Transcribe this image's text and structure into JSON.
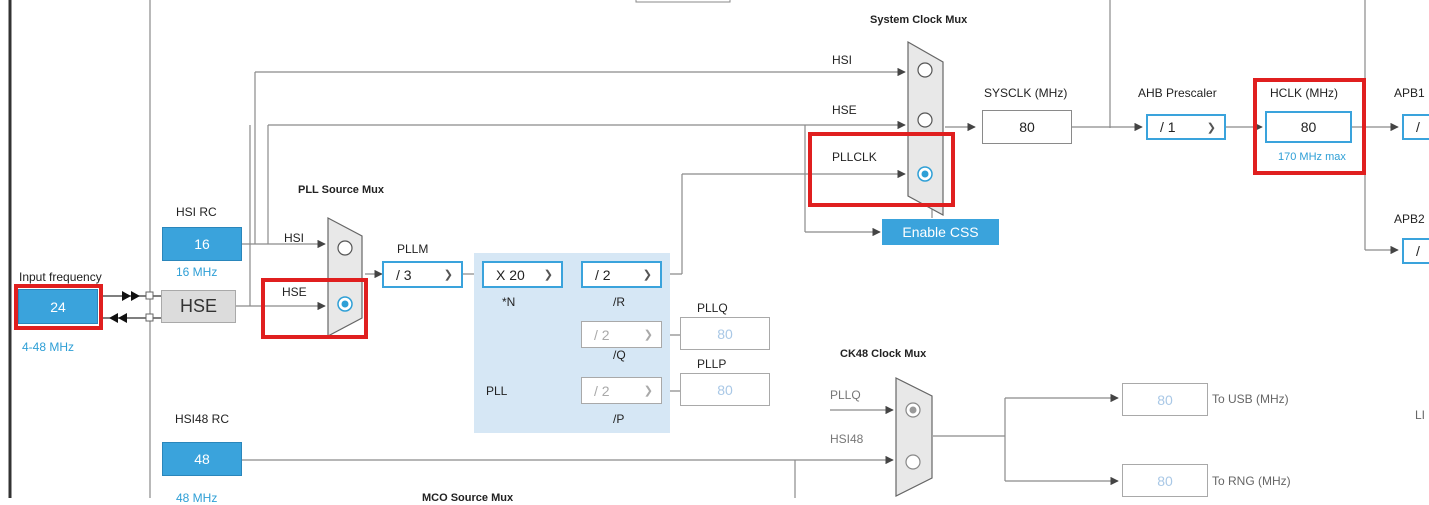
{
  "diagram": {
    "system_clock_mux": {
      "title": "System Clock Mux",
      "inputs": [
        "HSI",
        "HSE",
        "PLLCLK"
      ]
    },
    "sysclk": {
      "label": "SYSCLK (MHz)",
      "value": "80"
    },
    "ahb": {
      "label": "AHB Prescaler",
      "value": "/ 1"
    },
    "hclk": {
      "label": "HCLK (MHz)",
      "value": "80",
      "max": "170 MHz max"
    },
    "apb1": {
      "label": "APB1",
      "value": "/"
    },
    "apb2": {
      "label": "APB2",
      "value": "/"
    },
    "enable_css": "Enable CSS",
    "pll_source_mux": {
      "title": "PLL Source Mux",
      "inputs": [
        "HSI",
        "HSE"
      ]
    },
    "hsi_rc": {
      "label": "HSI RC",
      "value": "16",
      "freq": "16 MHz"
    },
    "input_frequency": {
      "label": "Input frequency",
      "value": "24",
      "range": "4-48 MHz"
    },
    "hse": "HSE",
    "pllm": {
      "label": "PLLM",
      "value": "/ 3"
    },
    "pll": {
      "label": "PLL",
      "n_value": "X 20",
      "n_label": "*N",
      "r_value": "/ 2",
      "r_label": "/R",
      "q_value": "/ 2",
      "q_label": "/Q",
      "p_value": "/ 2",
      "p_label": "/P"
    },
    "pllq": {
      "label": "PLLQ",
      "value": "80"
    },
    "pllp": {
      "label": "PLLP",
      "value": "80"
    },
    "ck48_mux": {
      "title": "CK48 Clock Mux",
      "inputs": [
        "PLLQ",
        "HSI48"
      ]
    },
    "to_usb": {
      "label": "To USB (MHz)",
      "value": "80"
    },
    "to_rng": {
      "label": "To RNG (MHz)",
      "value": "80"
    },
    "hsi48_rc": {
      "label": "HSI48 RC",
      "value": "48",
      "freq": "48 MHz"
    },
    "mco_source_mux": "MCO Source Mux",
    "right_edge_label": "LI"
  },
  "colors": {
    "accent": "#3aa3dc",
    "highlight": "#e01f1f",
    "pll_region": "#d6e7f5",
    "wire": "#8a8a8a"
  }
}
